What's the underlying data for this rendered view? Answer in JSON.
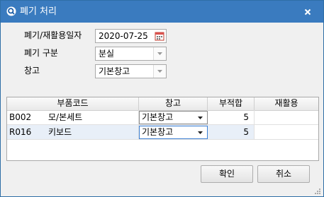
{
  "window": {
    "title": "폐기 처리"
  },
  "form": {
    "date_label": "폐기/재활용일자",
    "date_value": "2020-07-25",
    "type_label": "폐기 구분",
    "type_value": "분실",
    "warehouse_label": "창고",
    "warehouse_value": "기본창고"
  },
  "grid": {
    "columns": [
      "부품코드",
      "창고",
      "부적합",
      "재활용"
    ],
    "rows": [
      {
        "code": "B002",
        "name": "모/본세트",
        "warehouse": "기본창고",
        "defect": "5",
        "recycle": ""
      },
      {
        "code": "R016",
        "name": "키보드",
        "warehouse": "기본창고",
        "defect": "5",
        "recycle": ""
      }
    ]
  },
  "buttons": {
    "ok": "확인",
    "cancel": "취소"
  },
  "colors": {
    "titlebar": "#3a7bbf",
    "selected_row": "#e8eff8",
    "grid_border": "#a9a9a9"
  }
}
